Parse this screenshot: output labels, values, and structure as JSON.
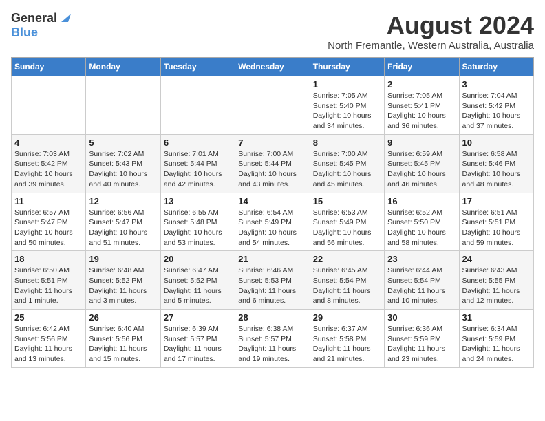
{
  "header": {
    "logo_general": "General",
    "logo_blue": "Blue",
    "title": "August 2024",
    "subtitle": "North Fremantle, Western Australia, Australia"
  },
  "calendar": {
    "columns": [
      "Sunday",
      "Monday",
      "Tuesday",
      "Wednesday",
      "Thursday",
      "Friday",
      "Saturday"
    ],
    "weeks": [
      [
        {
          "day": "",
          "info": ""
        },
        {
          "day": "",
          "info": ""
        },
        {
          "day": "",
          "info": ""
        },
        {
          "day": "",
          "info": ""
        },
        {
          "day": "1",
          "info": "Sunrise: 7:05 AM\nSunset: 5:40 PM\nDaylight: 10 hours\nand 34 minutes."
        },
        {
          "day": "2",
          "info": "Sunrise: 7:05 AM\nSunset: 5:41 PM\nDaylight: 10 hours\nand 36 minutes."
        },
        {
          "day": "3",
          "info": "Sunrise: 7:04 AM\nSunset: 5:42 PM\nDaylight: 10 hours\nand 37 minutes."
        }
      ],
      [
        {
          "day": "4",
          "info": "Sunrise: 7:03 AM\nSunset: 5:42 PM\nDaylight: 10 hours\nand 39 minutes."
        },
        {
          "day": "5",
          "info": "Sunrise: 7:02 AM\nSunset: 5:43 PM\nDaylight: 10 hours\nand 40 minutes."
        },
        {
          "day": "6",
          "info": "Sunrise: 7:01 AM\nSunset: 5:44 PM\nDaylight: 10 hours\nand 42 minutes."
        },
        {
          "day": "7",
          "info": "Sunrise: 7:00 AM\nSunset: 5:44 PM\nDaylight: 10 hours\nand 43 minutes."
        },
        {
          "day": "8",
          "info": "Sunrise: 7:00 AM\nSunset: 5:45 PM\nDaylight: 10 hours\nand 45 minutes."
        },
        {
          "day": "9",
          "info": "Sunrise: 6:59 AM\nSunset: 5:45 PM\nDaylight: 10 hours\nand 46 minutes."
        },
        {
          "day": "10",
          "info": "Sunrise: 6:58 AM\nSunset: 5:46 PM\nDaylight: 10 hours\nand 48 minutes."
        }
      ],
      [
        {
          "day": "11",
          "info": "Sunrise: 6:57 AM\nSunset: 5:47 PM\nDaylight: 10 hours\nand 50 minutes."
        },
        {
          "day": "12",
          "info": "Sunrise: 6:56 AM\nSunset: 5:47 PM\nDaylight: 10 hours\nand 51 minutes."
        },
        {
          "day": "13",
          "info": "Sunrise: 6:55 AM\nSunset: 5:48 PM\nDaylight: 10 hours\nand 53 minutes."
        },
        {
          "day": "14",
          "info": "Sunrise: 6:54 AM\nSunset: 5:49 PM\nDaylight: 10 hours\nand 54 minutes."
        },
        {
          "day": "15",
          "info": "Sunrise: 6:53 AM\nSunset: 5:49 PM\nDaylight: 10 hours\nand 56 minutes."
        },
        {
          "day": "16",
          "info": "Sunrise: 6:52 AM\nSunset: 5:50 PM\nDaylight: 10 hours\nand 58 minutes."
        },
        {
          "day": "17",
          "info": "Sunrise: 6:51 AM\nSunset: 5:51 PM\nDaylight: 10 hours\nand 59 minutes."
        }
      ],
      [
        {
          "day": "18",
          "info": "Sunrise: 6:50 AM\nSunset: 5:51 PM\nDaylight: 11 hours\nand 1 minute."
        },
        {
          "day": "19",
          "info": "Sunrise: 6:48 AM\nSunset: 5:52 PM\nDaylight: 11 hours\nand 3 minutes."
        },
        {
          "day": "20",
          "info": "Sunrise: 6:47 AM\nSunset: 5:52 PM\nDaylight: 11 hours\nand 5 minutes."
        },
        {
          "day": "21",
          "info": "Sunrise: 6:46 AM\nSunset: 5:53 PM\nDaylight: 11 hours\nand 6 minutes."
        },
        {
          "day": "22",
          "info": "Sunrise: 6:45 AM\nSunset: 5:54 PM\nDaylight: 11 hours\nand 8 minutes."
        },
        {
          "day": "23",
          "info": "Sunrise: 6:44 AM\nSunset: 5:54 PM\nDaylight: 11 hours\nand 10 minutes."
        },
        {
          "day": "24",
          "info": "Sunrise: 6:43 AM\nSunset: 5:55 PM\nDaylight: 11 hours\nand 12 minutes."
        }
      ],
      [
        {
          "day": "25",
          "info": "Sunrise: 6:42 AM\nSunset: 5:56 PM\nDaylight: 11 hours\nand 13 minutes."
        },
        {
          "day": "26",
          "info": "Sunrise: 6:40 AM\nSunset: 5:56 PM\nDaylight: 11 hours\nand 15 minutes."
        },
        {
          "day": "27",
          "info": "Sunrise: 6:39 AM\nSunset: 5:57 PM\nDaylight: 11 hours\nand 17 minutes."
        },
        {
          "day": "28",
          "info": "Sunrise: 6:38 AM\nSunset: 5:57 PM\nDaylight: 11 hours\nand 19 minutes."
        },
        {
          "day": "29",
          "info": "Sunrise: 6:37 AM\nSunset: 5:58 PM\nDaylight: 11 hours\nand 21 minutes."
        },
        {
          "day": "30",
          "info": "Sunrise: 6:36 AM\nSunset: 5:59 PM\nDaylight: 11 hours\nand 23 minutes."
        },
        {
          "day": "31",
          "info": "Sunrise: 6:34 AM\nSunset: 5:59 PM\nDaylight: 11 hours\nand 24 minutes."
        }
      ]
    ]
  }
}
